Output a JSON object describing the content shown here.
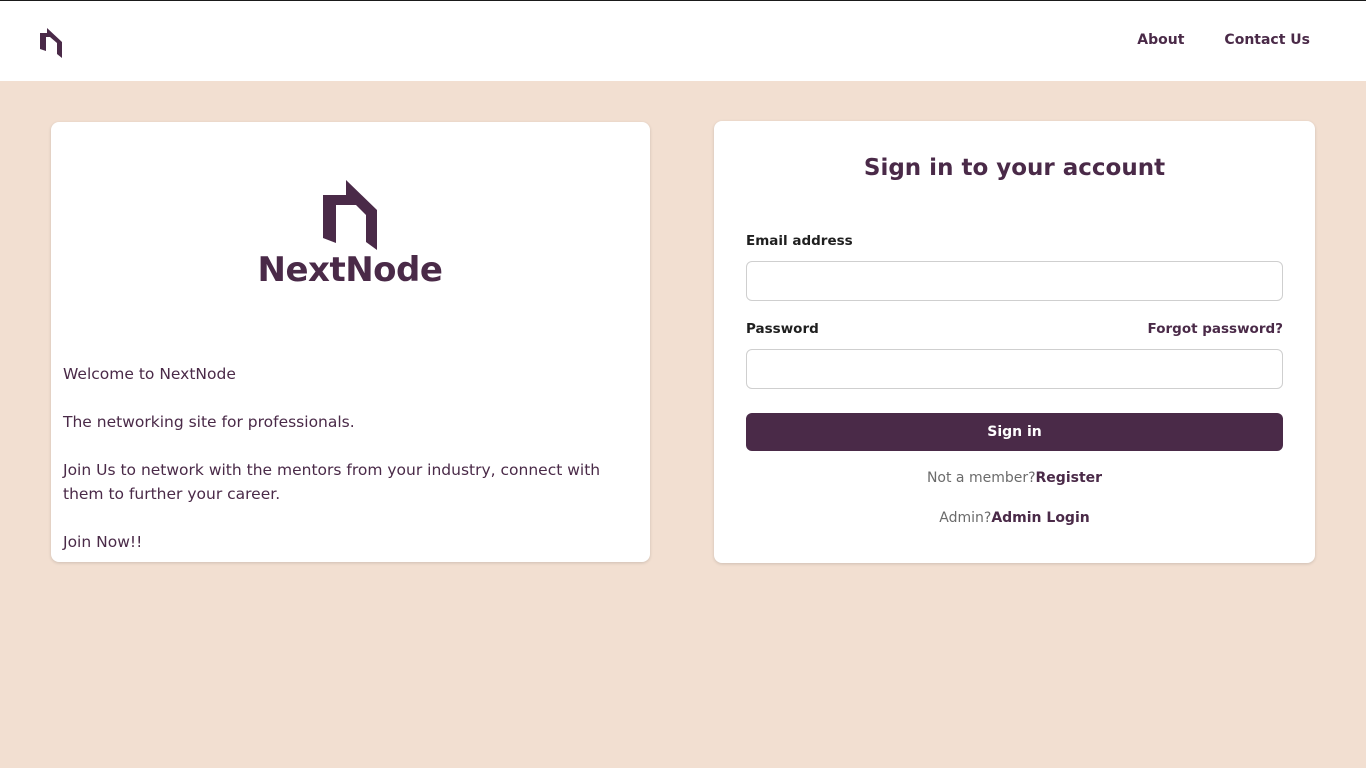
{
  "nav": {
    "logo_icon": "nextnode-mark-icon",
    "links": [
      "About",
      "Contact Us"
    ]
  },
  "brand": {
    "name": "NextNode",
    "color": "#4a2a48"
  },
  "welcome": {
    "line1": "Welcome to NextNode",
    "line2": "The networking site for professionals.",
    "line3": "Join Us to network with the mentors from your industry, connect with them to further your career.",
    "line4": "Join Now!!"
  },
  "signin": {
    "title": "Sign in to your account",
    "email_label": "Email address",
    "email_value": "",
    "password_label": "Password",
    "password_value": "",
    "forgot_label": "Forgot password?",
    "button_label": "Sign in",
    "not_member_text": "Not a member?",
    "register_label": "Register",
    "admin_text": "Admin?",
    "admin_login_label": "Admin Login"
  },
  "colors": {
    "accent": "#4a2a48",
    "background": "#f2dfd1",
    "card": "#ffffff"
  }
}
